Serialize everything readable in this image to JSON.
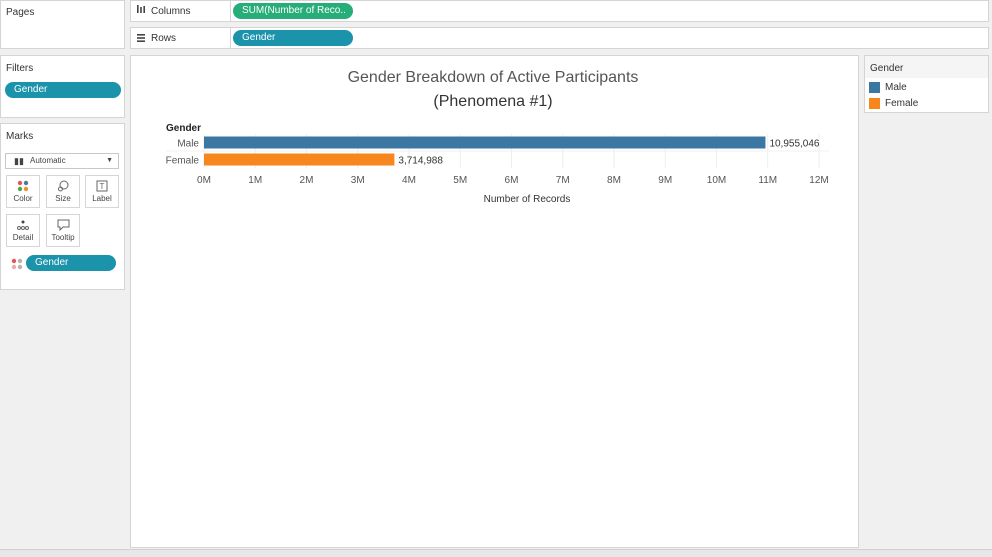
{
  "pages_card": {
    "title": "Pages"
  },
  "filters_card": {
    "title": "Filters",
    "pills": [
      "Gender"
    ]
  },
  "marks_card": {
    "title": "Marks",
    "mark_type": "Automatic",
    "buttons": {
      "color": "Color",
      "size": "Size",
      "label": "Label",
      "detail": "Detail",
      "tooltip": "Tooltip"
    },
    "pill": "Gender"
  },
  "shelves": {
    "columns": {
      "label": "Columns",
      "pill": "SUM(Number of Reco..",
      "icon": "columns-icon"
    },
    "rows": {
      "label": "Rows",
      "pill": "Gender",
      "icon": "rows-icon"
    }
  },
  "legend": {
    "title": "Gender",
    "items": [
      {
        "label": "Male",
        "color": "#3a77a3"
      },
      {
        "label": "Female",
        "color": "#f7861d"
      }
    ]
  },
  "chart_data": {
    "type": "bar",
    "orientation": "horizontal",
    "title": "Gender Breakdown of Active Participants",
    "subtitle": "(Phenomena #1)",
    "row_header": "Gender",
    "categories": [
      "Male",
      "Female"
    ],
    "values": [
      10955046,
      3714988
    ],
    "value_labels": [
      "10,955,046",
      "3,714,988"
    ],
    "colors": [
      "#3a77a3",
      "#f7861d"
    ],
    "xlabel": "Number of Records",
    "xlim": [
      0,
      12000000
    ],
    "ticks": [
      0,
      1000000,
      2000000,
      3000000,
      4000000,
      5000000,
      6000000,
      7000000,
      8000000,
      9000000,
      10000000,
      11000000,
      12000000
    ],
    "tick_labels": [
      "0M",
      "1M",
      "2M",
      "3M",
      "4M",
      "5M",
      "6M",
      "7M",
      "8M",
      "9M",
      "10M",
      "11M",
      "12M"
    ],
    "grid": true
  }
}
